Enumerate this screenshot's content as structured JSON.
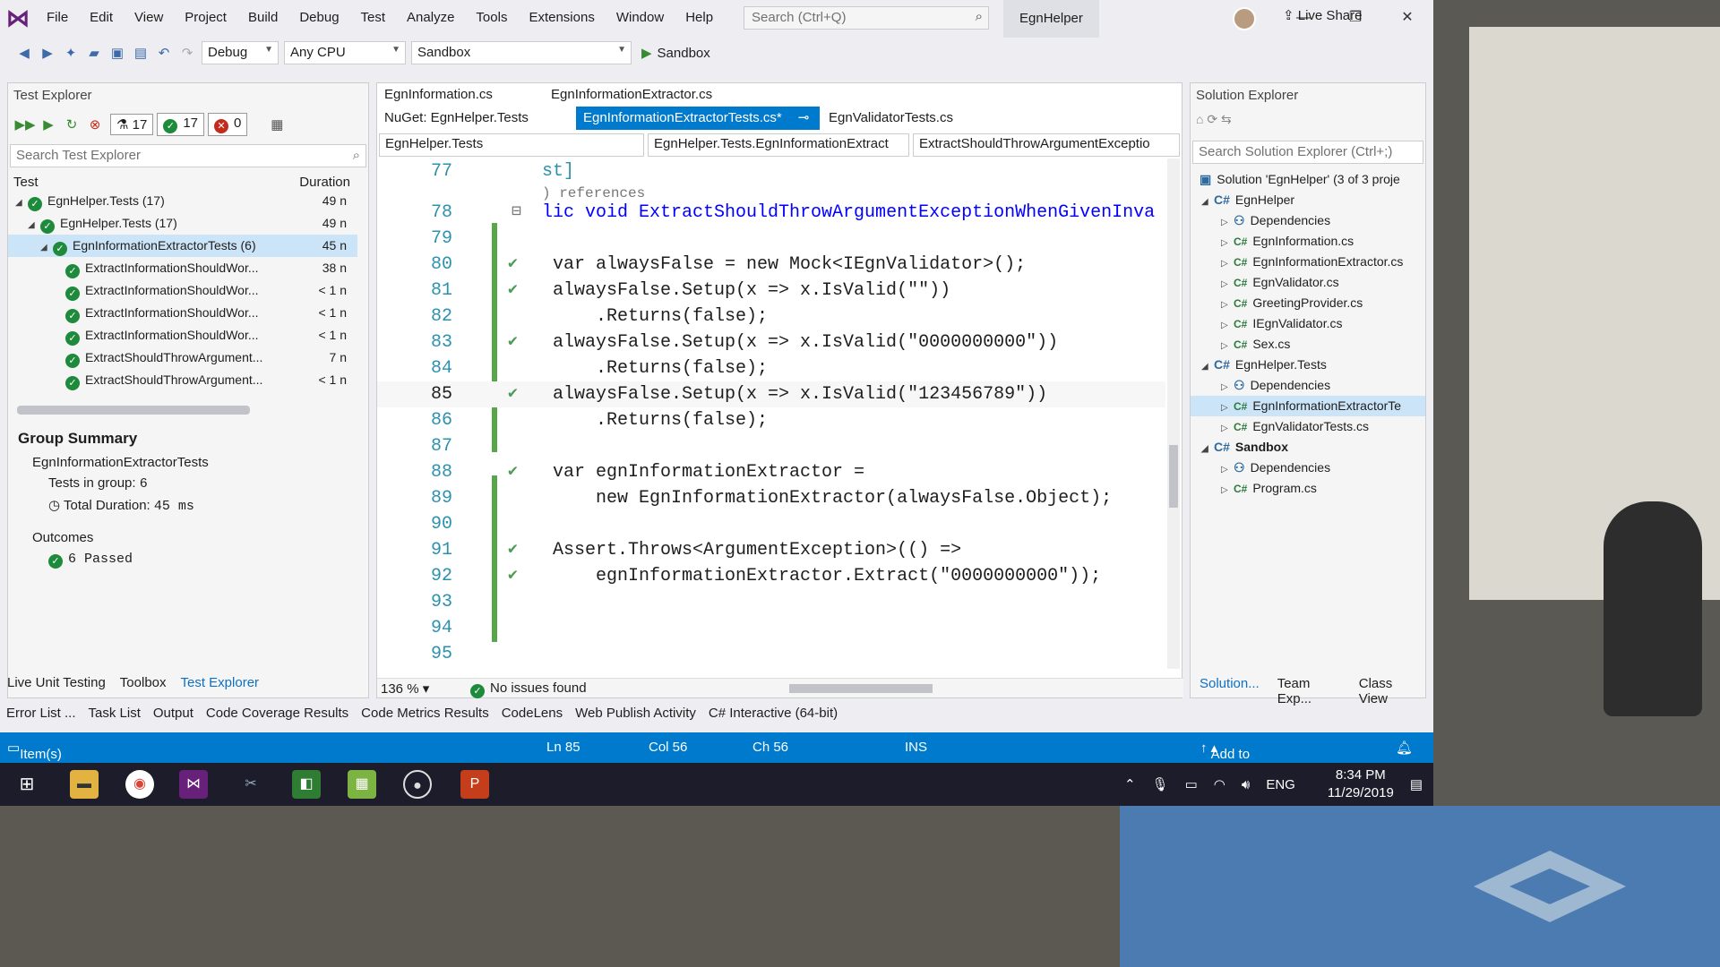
{
  "menubar": {
    "items": [
      "File",
      "Edit",
      "View",
      "Project",
      "Build",
      "Debug",
      "Test",
      "Analyze",
      "Tools",
      "Extensions",
      "Window",
      "Help"
    ],
    "search_placeholder": "Search (Ctrl+Q)",
    "solution_name": "EgnHelper"
  },
  "toolbar": {
    "config": "Debug",
    "platform": "Any CPU",
    "startup": "Sandbox",
    "run_label": "Sandbox",
    "live_share": "Live Share"
  },
  "test_explorer": {
    "title": "Test Explorer",
    "count_total": "17",
    "count_passed": "17",
    "count_failed": "0",
    "search_placeholder": "Search Test Explorer",
    "col_test": "Test",
    "col_duration": "Duration",
    "rows": [
      {
        "name": "EgnHelper.Tests (17)",
        "dur": "49 n"
      },
      {
        "name": "EgnHelper.Tests (17)",
        "dur": "49 n"
      },
      {
        "name": "EgnInformationExtractorTests (6)",
        "dur": "45 n"
      },
      {
        "name": "ExtractInformationShouldWor...",
        "dur": "38 n"
      },
      {
        "name": "ExtractInformationShouldWor...",
        "dur": "< 1 n"
      },
      {
        "name": "ExtractInformationShouldWor...",
        "dur": "< 1 n"
      },
      {
        "name": "ExtractInformationShouldWor...",
        "dur": "< 1 n"
      },
      {
        "name": "ExtractShouldThrowArgument...",
        "dur": "7 n"
      },
      {
        "name": "ExtractShouldThrowArgument...",
        "dur": "< 1 n"
      }
    ],
    "group_summary": {
      "title": "Group Summary",
      "group": "EgnInformationExtractorTests",
      "tests_label": "Tests in group:",
      "tests_value": "6",
      "duration_label": "Total Duration:",
      "duration_value": "45 ms",
      "outcomes": "Outcomes",
      "passed": "6 Passed"
    },
    "tabs": [
      "Live Unit Testing",
      "Toolbox",
      "Test Explorer"
    ]
  },
  "editor": {
    "tabs": [
      "EgnInformation.cs",
      "EgnInformationExtractor.cs",
      "NuGet: EgnHelper.Tests",
      "EgnInformationExtractorTests.cs*",
      "EgnValidatorTests.cs"
    ],
    "nav": [
      "EgnHelper.Tests",
      "EgnHelper.Tests.EgnInformationExtract",
      "ExtractShouldThrowArgumentExceptio"
    ],
    "lines": [
      {
        "n": "77",
        "text": "st]"
      },
      {
        "n": "",
        "text": ") references"
      },
      {
        "n": "78",
        "text": "lic void ExtractShouldThrowArgumentExceptionWhenGivenInva"
      },
      {
        "n": "79",
        "text": ""
      },
      {
        "n": "80",
        "text": "var alwaysFalse = new Mock<IEgnValidator>();"
      },
      {
        "n": "81",
        "text": "alwaysFalse.Setup(x => x.IsValid(\"\"))"
      },
      {
        "n": "82",
        "text": "    .Returns(false);"
      },
      {
        "n": "83",
        "text": "alwaysFalse.Setup(x => x.IsValid(\"0000000000\"))"
      },
      {
        "n": "84",
        "text": "    .Returns(false);"
      },
      {
        "n": "85",
        "text": "alwaysFalse.Setup(x => x.IsValid(\"123456789\"))"
      },
      {
        "n": "86",
        "text": "    .Returns(false);"
      },
      {
        "n": "87",
        "text": ""
      },
      {
        "n": "88",
        "text": "var egnInformationExtractor ="
      },
      {
        "n": "89",
        "text": "    new EgnInformationExtractor(alwaysFalse.Object);"
      },
      {
        "n": "90",
        "text": ""
      },
      {
        "n": "91",
        "text": "Assert.Throws<ArgumentException>(() =>"
      },
      {
        "n": "92",
        "text": "    egnInformationExtractor.Extract(\"0000000000\"));"
      },
      {
        "n": "93",
        "text": ""
      },
      {
        "n": "94",
        "text": ""
      },
      {
        "n": "95",
        "text": ""
      }
    ],
    "zoom": "136 %",
    "issues": "No issues found"
  },
  "solution_explorer": {
    "title": "Solution Explorer",
    "search_placeholder": "Search Solution Explorer (Ctrl+;)",
    "rows": [
      {
        "text": "Solution 'EgnHelper' (3 of 3 proje"
      },
      {
        "text": "EgnHelper"
      },
      {
        "text": "Dependencies"
      },
      {
        "text": "EgnInformation.cs"
      },
      {
        "text": "EgnInformationExtractor.cs"
      },
      {
        "text": "EgnValidator.cs"
      },
      {
        "text": "GreetingProvider.cs"
      },
      {
        "text": "IEgnValidator.cs"
      },
      {
        "text": "Sex.cs"
      },
      {
        "text": "EgnHelper.Tests"
      },
      {
        "text": "Dependencies"
      },
      {
        "text": "EgnInformationExtractorTe"
      },
      {
        "text": "EgnValidatorTests.cs"
      },
      {
        "text": "Sandbox"
      },
      {
        "text": "Dependencies"
      },
      {
        "text": "Program.cs"
      }
    ],
    "tabs": [
      "Solution...",
      "Team Exp...",
      "Class View"
    ]
  },
  "bottom_tabs": [
    "Error List ...",
    "Task List",
    "Output",
    "Code Coverage Results",
    "Code Metrics Results",
    "CodeLens",
    "Web Publish Activity",
    "C# Interactive (64-bit)"
  ],
  "statusbar": {
    "message": "Item(s) Saved",
    "ln": "Ln 85",
    "col": "Col 56",
    "ch": "Ch 56",
    "mode": "INS",
    "source_control": "Add to Source Control"
  },
  "taskbar": {
    "lang": "ENG",
    "time": "8:34 PM",
    "date": "11/29/2019"
  },
  "colors": {
    "accent": "#007acc",
    "pass": "#1e8a3c",
    "vs_purple": "#68217a"
  }
}
